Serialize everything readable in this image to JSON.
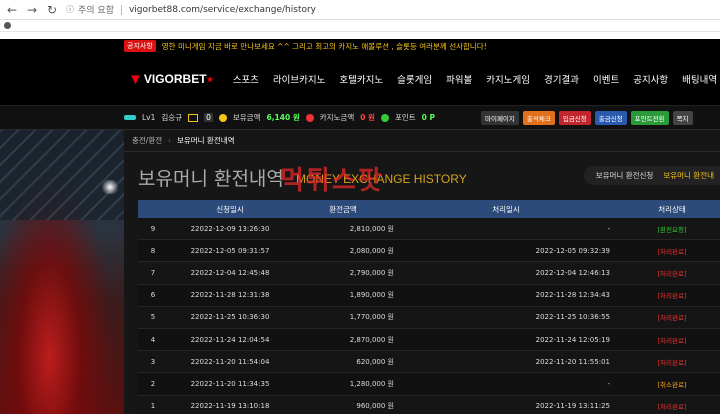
{
  "browser": {
    "warning": "주의 요함",
    "url": "vigorbet88.com/service/exchange/history"
  },
  "notice": {
    "badge": "공지사항",
    "text": "영한 미니게임 지금 바로 만나보세요 ^^ 그리고 최고의 카지노 애볼루션 , 슬롯등 여러분께 선사합니다!"
  },
  "logo": {
    "text": "VIGORBET"
  },
  "menu": [
    "스포츠",
    "라이브카지노",
    "호텔카지노",
    "슬롯게임",
    "파워볼",
    "카지노게임",
    "경기결과",
    "이벤트",
    "공지사항",
    "배팅내역",
    "고"
  ],
  "user": {
    "level": "Lv1",
    "name": "김승규",
    "mail_count": "0",
    "balance_label": "보유금액",
    "balance_value": "6,140 원",
    "casino_label": "카지노금액",
    "casino_value": "0 원",
    "point_label": "포인트",
    "point_value": "0 P"
  },
  "buttons": [
    {
      "label": "마이페이지",
      "color": "#333333"
    },
    {
      "label": "출석체크",
      "color": "#e0701a"
    },
    {
      "label": "입금신청",
      "color": "#c0262c"
    },
    {
      "label": "출금신청",
      "color": "#2a5ab0"
    },
    {
      "label": "포인트전환",
      "color": "#2a9a3a"
    },
    {
      "label": "쪽지",
      "color": "#444444"
    }
  ],
  "breadcrumb": {
    "first": "충전/환전",
    "current": "보유머니 환전내역"
  },
  "page": {
    "title_ko": "보유머니 환전내역",
    "title_en": "MONEY EXCHANGE HISTORY",
    "watermark": "먹튀스팟"
  },
  "tabs": [
    {
      "label": "보유머니 환전신청",
      "active": false
    },
    {
      "label": "보유머니 환전내",
      "active": true
    }
  ],
  "table": {
    "headers": [
      "",
      "신청일시",
      "환전금액",
      "처리일시",
      "처리상태"
    ],
    "rows": [
      {
        "no": "9",
        "date": "22022-12-09 13:26:30",
        "amount": "2,810,000 원",
        "processed": "-",
        "status": "[환전요청]",
        "status_type": "green"
      },
      {
        "no": "8",
        "date": "22022-12-05 09:31:57",
        "amount": "2,080,000 원",
        "processed": "2022-12-05 09:32:39",
        "status": "[처리완료]",
        "status_type": "red"
      },
      {
        "no": "7",
        "date": "22022-12-04 12:45:48",
        "amount": "2,790,000 원",
        "processed": "2022-12-04 12:46:13",
        "status": "[처리완료]",
        "status_type": "red"
      },
      {
        "no": "6",
        "date": "22022-11-28 12:31:38",
        "amount": "1,890,000 원",
        "processed": "2022-11-28 12:34:43",
        "status": "[처리완료]",
        "status_type": "red"
      },
      {
        "no": "5",
        "date": "22022-11-25 10:36:30",
        "amount": "1,770,000 원",
        "processed": "2022-11-25 10:36:55",
        "status": "[처리완료]",
        "status_type": "red"
      },
      {
        "no": "4",
        "date": "22022-11-24 12:04:54",
        "amount": "2,870,000 원",
        "processed": "2022-11-24 12:05:19",
        "status": "[처리완료]",
        "status_type": "red"
      },
      {
        "no": "3",
        "date": "22022-11-20 11:54:04",
        "amount": "620,000 원",
        "processed": "2022-11-20 11:55:01",
        "status": "[처리완료]",
        "status_type": "red"
      },
      {
        "no": "2",
        "date": "22022-11-20 11:34:35",
        "amount": "1,280,000 원",
        "processed": "-",
        "status": "[취소완료]",
        "status_type": "orange"
      },
      {
        "no": "1",
        "date": "22022-11-19 13:10:18",
        "amount": "960,000 원",
        "processed": "2022-11-19 13:11:25",
        "status": "[처리완료]",
        "status_type": "red"
      }
    ]
  }
}
